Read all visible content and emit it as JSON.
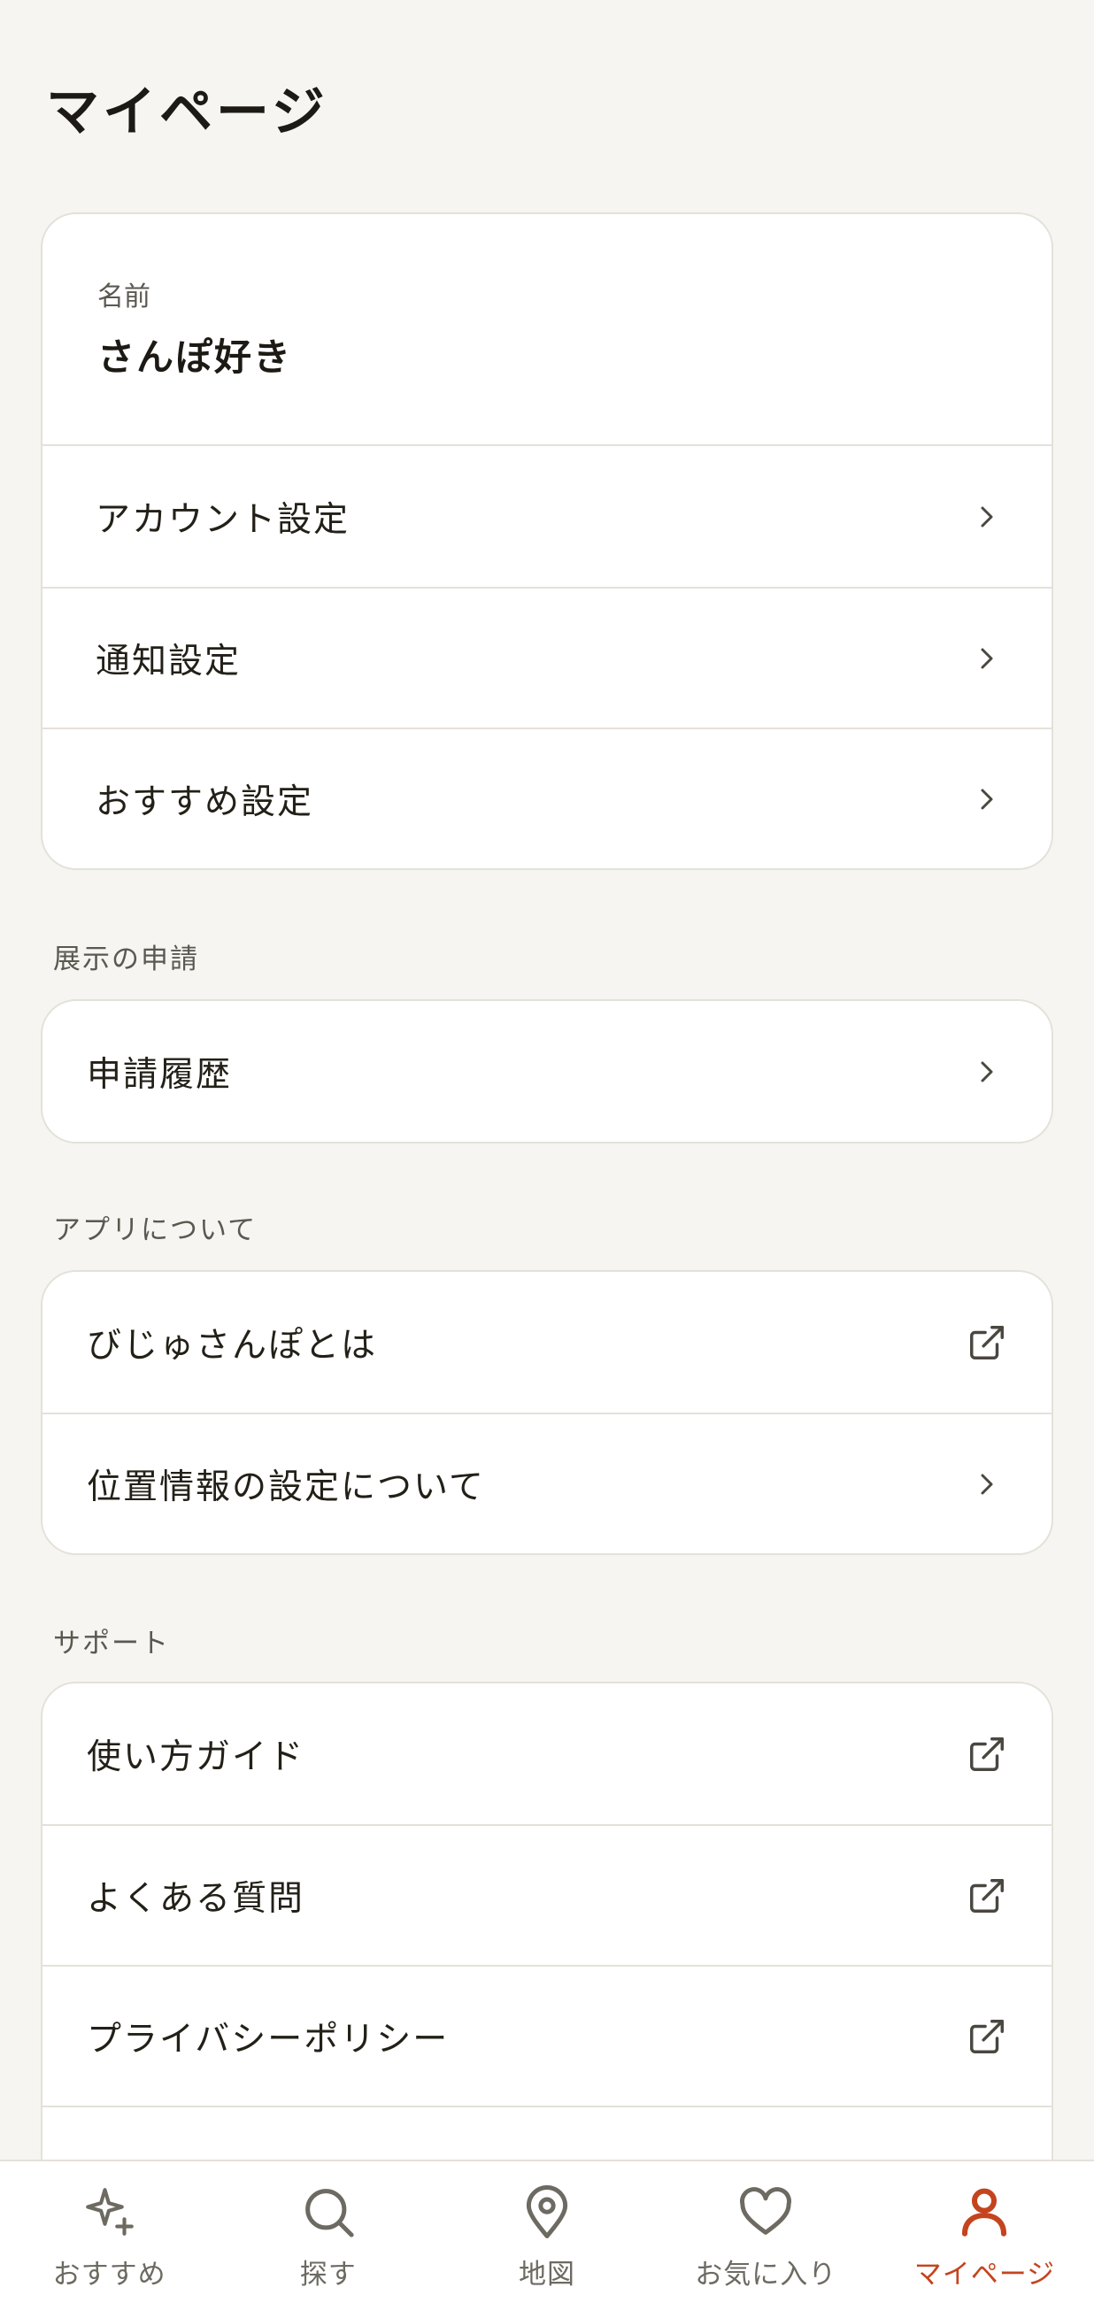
{
  "page_title": "マイページ",
  "profile": {
    "label": "名前",
    "name": "さんぽ好き"
  },
  "account_menu": [
    {
      "label": "アカウント設定",
      "icon": "chevron-right-icon"
    },
    {
      "label": "通知設定",
      "icon": "chevron-right-icon"
    },
    {
      "label": "おすすめ設定",
      "icon": "chevron-right-icon"
    }
  ],
  "exhibit_section": {
    "title": "展示の申請",
    "items": [
      {
        "label": "申請履歴",
        "icon": "chevron-right-icon"
      }
    ]
  },
  "about_section": {
    "title": "アプリについて",
    "items": [
      {
        "label": "びじゅさんぽとは",
        "icon": "external-link-icon"
      },
      {
        "label": "位置情報の設定について",
        "icon": "chevron-right-icon"
      }
    ]
  },
  "support_section": {
    "title": "サポート",
    "items": [
      {
        "label": "使い方ガイド",
        "icon": "external-link-icon"
      },
      {
        "label": "よくある質問",
        "icon": "external-link-icon"
      },
      {
        "label": "プライバシーポリシー",
        "icon": "external-link-icon"
      }
    ]
  },
  "tabbar": {
    "active_color": "#c4441e",
    "inactive_color": "#6d6a62",
    "items": [
      {
        "label": "おすすめ",
        "icon": "sparkle-icon"
      },
      {
        "label": "探す",
        "icon": "search-icon"
      },
      {
        "label": "地図",
        "icon": "map-pin-icon"
      },
      {
        "label": "お気に入り",
        "icon": "heart-icon"
      },
      {
        "label": "マイページ",
        "icon": "user-icon",
        "active": true
      }
    ]
  }
}
